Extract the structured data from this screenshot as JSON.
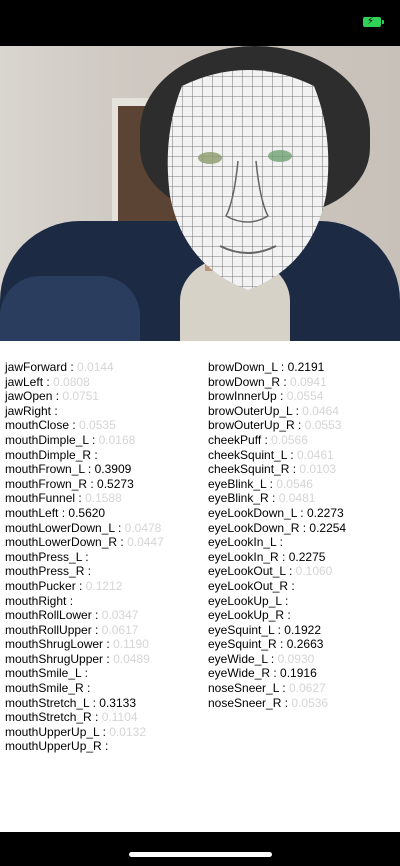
{
  "status_bar": {
    "battery_color": "#30d158",
    "battery_icon": "charging-battery-icon"
  },
  "left_column": [
    {
      "name": "jawForward",
      "value": "0.0144",
      "emph": false
    },
    {
      "name": "jawLeft",
      "value": "0.0808",
      "emph": false
    },
    {
      "name": "jawOpen",
      "value": "0.0751",
      "emph": false
    },
    {
      "name": "jawRight",
      "value": "",
      "emph": false
    },
    {
      "name": "mouthClose",
      "value": "0.0535",
      "emph": false
    },
    {
      "name": "mouthDimple_L",
      "value": "0.0168",
      "emph": false
    },
    {
      "name": "mouthDimple_R",
      "value": "",
      "emph": false
    },
    {
      "name": "mouthFrown_L",
      "value": "0.3909",
      "emph": true
    },
    {
      "name": "mouthFrown_R",
      "value": "0.5273",
      "emph": true
    },
    {
      "name": "mouthFunnel",
      "value": "0.1588",
      "emph": false
    },
    {
      "name": "mouthLeft",
      "value": "0.5620",
      "emph": true
    },
    {
      "name": "mouthLowerDown_L",
      "value": "0.0478",
      "emph": false
    },
    {
      "name": "mouthLowerDown_R",
      "value": "0.0447",
      "emph": false
    },
    {
      "name": "mouthPress_L",
      "value": "",
      "emph": false
    },
    {
      "name": "mouthPress_R",
      "value": "",
      "emph": false
    },
    {
      "name": "mouthPucker",
      "value": "0.1212",
      "emph": false
    },
    {
      "name": "mouthRight",
      "value": "",
      "emph": false
    },
    {
      "name": "mouthRollLower",
      "value": "0.0347",
      "emph": false
    },
    {
      "name": "mouthRollUpper",
      "value": "0.0617",
      "emph": false
    },
    {
      "name": "mouthShrugLower",
      "value": "0.1190",
      "emph": false
    },
    {
      "name": "mouthShrugUpper",
      "value": "0.0489",
      "emph": false
    },
    {
      "name": "mouthSmile_L",
      "value": "",
      "emph": false
    },
    {
      "name": "mouthSmile_R",
      "value": "",
      "emph": false
    },
    {
      "name": "mouthStretch_L",
      "value": "0.3133",
      "emph": true
    },
    {
      "name": "mouthStretch_R",
      "value": "0.1104",
      "emph": false
    },
    {
      "name": "mouthUpperUp_L",
      "value": "0.0132",
      "emph": false
    },
    {
      "name": "mouthUpperUp_R",
      "value": "",
      "emph": false
    }
  ],
  "right_column": [
    {
      "name": "browDown_L",
      "value": "0.2191",
      "emph": true
    },
    {
      "name": "browDown_R",
      "value": "0.0941",
      "emph": false
    },
    {
      "name": "browInnerUp",
      "value": "0.0554",
      "emph": false
    },
    {
      "name": "browOuterUp_L",
      "value": "0.0464",
      "emph": false
    },
    {
      "name": "browOuterUp_R",
      "value": "0.0553",
      "emph": false
    },
    {
      "name": "cheekPuff",
      "value": "0.0566",
      "emph": false
    },
    {
      "name": "cheekSquint_L",
      "value": "0.0461",
      "emph": false
    },
    {
      "name": "cheekSquint_R",
      "value": "0.0103",
      "emph": false
    },
    {
      "name": "eyeBlink_L",
      "value": "0.0546",
      "emph": false
    },
    {
      "name": "eyeBlink_R",
      "value": "0.0481",
      "emph": false
    },
    {
      "name": "eyeLookDown_L",
      "value": "0.2273",
      "emph": true
    },
    {
      "name": "eyeLookDown_R",
      "value": "0.2254",
      "emph": true
    },
    {
      "name": "eyeLookIn_L",
      "value": "",
      "emph": false
    },
    {
      "name": "eyeLookIn_R",
      "value": "0.2275",
      "emph": true
    },
    {
      "name": "eyeLookOut_L",
      "value": "0.1060",
      "emph": false
    },
    {
      "name": "eyeLookOut_R",
      "value": "",
      "emph": false
    },
    {
      "name": "eyeLookUp_L",
      "value": "",
      "emph": false
    },
    {
      "name": "eyeLookUp_R",
      "value": "",
      "emph": false
    },
    {
      "name": "eyeSquint_L",
      "value": "0.1922",
      "emph": true
    },
    {
      "name": "eyeSquint_R",
      "value": "0.2663",
      "emph": true
    },
    {
      "name": "eyeWide_L",
      "value": "0.0930",
      "emph": false
    },
    {
      "name": "eyeWide_R",
      "value": "0.1916",
      "emph": true
    },
    {
      "name": "noseSneer_L",
      "value": "0.0627",
      "emph": false
    },
    {
      "name": "noseSneer_R",
      "value": "0.0536",
      "emph": false
    }
  ]
}
